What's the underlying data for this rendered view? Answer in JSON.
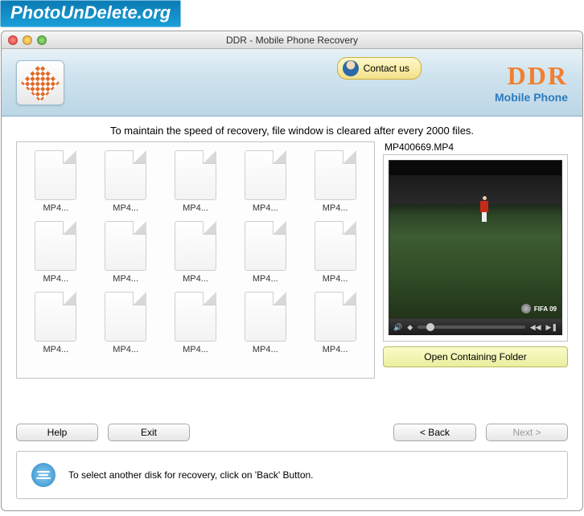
{
  "site_logo": "PhotoUnDelete.org",
  "titlebar": {
    "title": "DDR - Mobile Phone Recovery"
  },
  "banner": {
    "contact_label": "Contact us",
    "brand": "DDR",
    "brand_sub": "Mobile Phone"
  },
  "notice": "To maintain the speed of recovery, file window is cleared after every 2000 files.",
  "files": [
    {
      "label": "MP4..."
    },
    {
      "label": "MP4..."
    },
    {
      "label": "MP4..."
    },
    {
      "label": "MP4..."
    },
    {
      "label": "MP4..."
    },
    {
      "label": "MP4..."
    },
    {
      "label": "MP4..."
    },
    {
      "label": "MP4..."
    },
    {
      "label": "MP4..."
    },
    {
      "label": "MP4..."
    },
    {
      "label": "MP4..."
    },
    {
      "label": "MP4..."
    },
    {
      "label": "MP4..."
    },
    {
      "label": "MP4..."
    },
    {
      "label": "MP4..."
    }
  ],
  "preview": {
    "filename": "MP400669.MP4",
    "badge_text": "FIFA 09",
    "open_folder_label": "Open Containing Folder"
  },
  "buttons": {
    "help": "Help",
    "exit": "Exit",
    "back": "< Back",
    "next": "Next >"
  },
  "hint": "To select another disk for recovery, click on 'Back' Button."
}
